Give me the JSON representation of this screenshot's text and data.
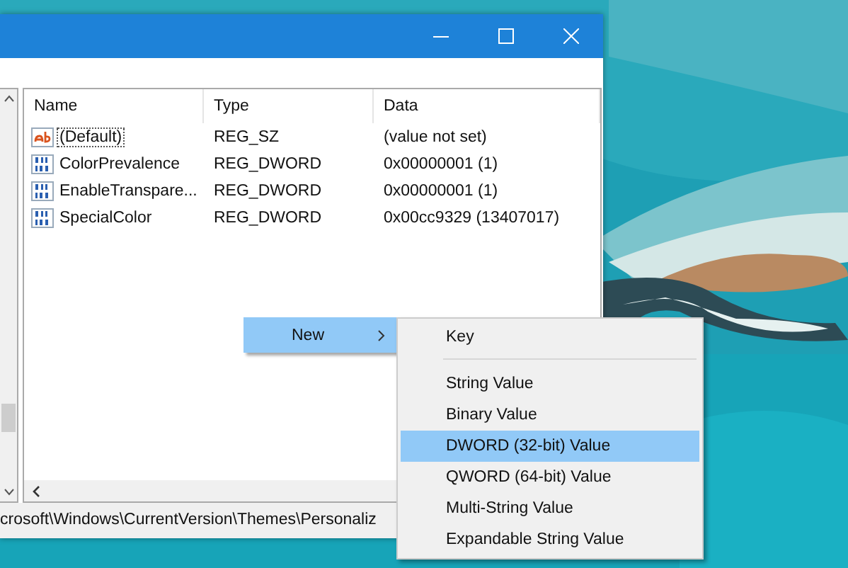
{
  "window": {
    "controls": [
      {
        "kind": "minimize"
      },
      {
        "kind": "maximize"
      },
      {
        "kind": "close"
      }
    ]
  },
  "values_list": {
    "columns": [
      "Name",
      "Type",
      "Data"
    ],
    "rows": [
      {
        "kind": "string",
        "name": "(Default)",
        "type": "REG_SZ",
        "data": "(value not set)",
        "focused": true
      },
      {
        "kind": "binary",
        "name": "ColorPrevalence",
        "type": "REG_DWORD",
        "data": "0x00000001 (1)",
        "focused": false
      },
      {
        "kind": "binary",
        "name": "EnableTranspare...",
        "type": "REG_DWORD",
        "data": "0x00000001 (1)",
        "focused": false
      },
      {
        "kind": "binary",
        "name": "SpecialColor",
        "type": "REG_DWORD",
        "data": "0x00cc9329 (13407017)",
        "focused": false
      }
    ]
  },
  "status_bar": "crosoft\\Windows\\CurrentVersion\\Themes\\Personaliz",
  "context_menu": {
    "items": [
      {
        "label": "New",
        "submenu": true,
        "selected": true
      }
    ]
  },
  "submenu": {
    "items": [
      {
        "kind": "item",
        "label": "Key",
        "selected": false
      },
      {
        "kind": "separator"
      },
      {
        "kind": "item",
        "label": "String Value",
        "selected": false
      },
      {
        "kind": "item",
        "label": "Binary Value",
        "selected": false
      },
      {
        "kind": "item",
        "label": "DWORD (32-bit) Value",
        "selected": true
      },
      {
        "kind": "item",
        "label": "QWORD (64-bit) Value",
        "selected": false
      },
      {
        "kind": "item",
        "label": "Multi-String Value",
        "selected": false
      },
      {
        "kind": "item",
        "label": "Expandable String Value",
        "selected": false
      }
    ]
  }
}
